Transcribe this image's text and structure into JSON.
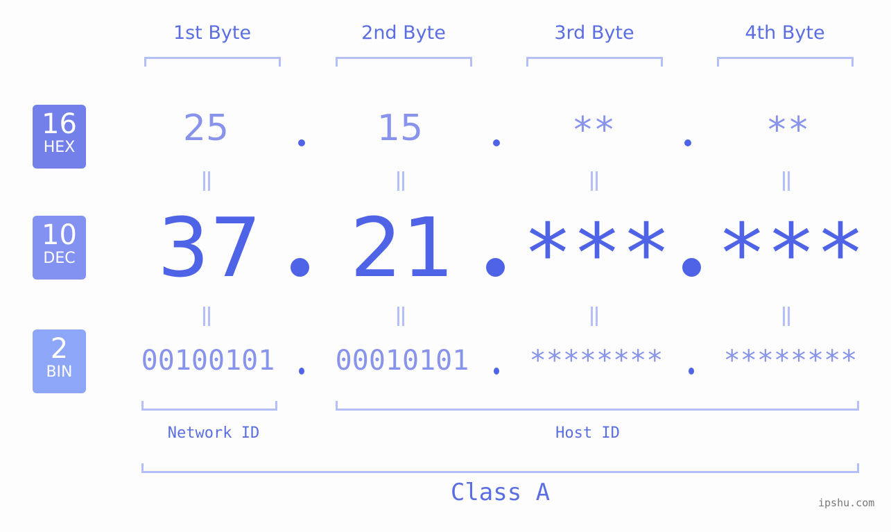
{
  "bytes": [
    {
      "label": "1st Byte",
      "hex": "25",
      "dec": "37",
      "bin": "00100101"
    },
    {
      "label": "2nd Byte",
      "hex": "15",
      "dec": "21",
      "bin": "00010101"
    },
    {
      "label": "3rd Byte",
      "hex": "**",
      "dec": "***",
      "bin": "********"
    },
    {
      "label": "4th Byte",
      "hex": "**",
      "dec": "***",
      "bin": "********"
    }
  ],
  "badges": [
    {
      "number": "16",
      "label": "HEX",
      "color": "#7480ea"
    },
    {
      "number": "10",
      "label": "DEC",
      "color": "#8391f0"
    },
    {
      "number": "2",
      "label": "BIN",
      "color": "#8ea6f8"
    }
  ],
  "separator": ".",
  "network_id_label": "Network ID",
  "host_id_label": "Host ID",
  "class_label": "Class A",
  "watermark": "ipshu.com",
  "colors": {
    "accent": "#4e63e6",
    "light_value": "#8893eb",
    "bracket": "#b4bff7",
    "label_text": "#5b6ee1"
  }
}
